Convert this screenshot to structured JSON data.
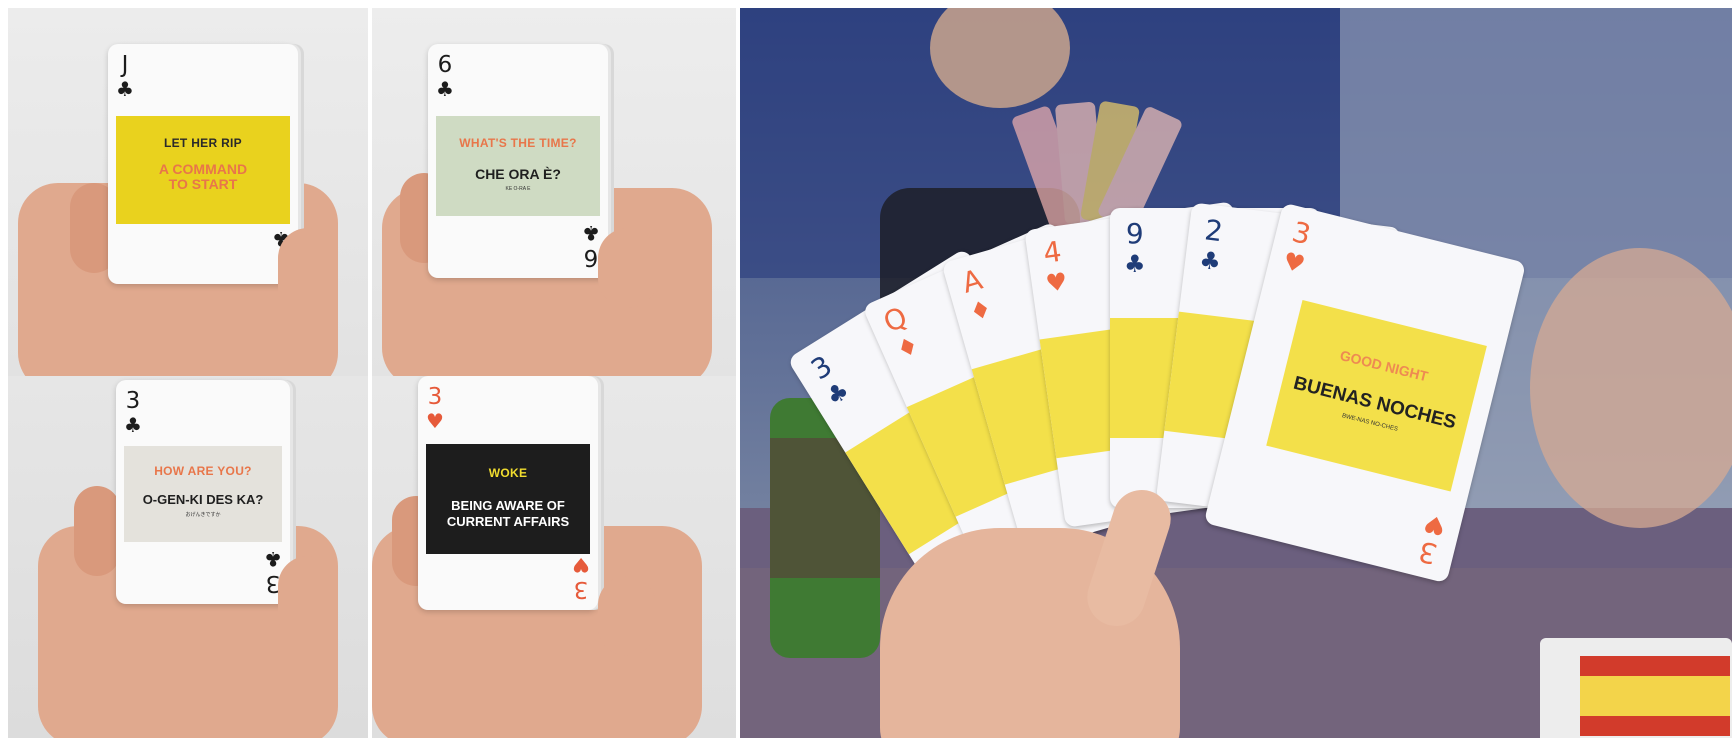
{
  "cards": {
    "jack_clubs": {
      "rank": "J",
      "suit": "♣",
      "phrase": "LET HER RIP",
      "translation": "A COMMAND\nTO START",
      "phonetic": "",
      "band_color": "#e9d21e",
      "phrase_color": "#2a2a2a",
      "translation_color": "#e8764a"
    },
    "six_clubs": {
      "rank": "6",
      "suit": "♣",
      "phrase": "WHAT'S THE TIME?",
      "translation": "CHE ORA È?",
      "phonetic": "KE O-RA E",
      "band_color": "#cfdbc3",
      "phrase_color": "#e8764a",
      "translation_color": "#1f1f1f"
    },
    "three_clubs": {
      "rank": "3",
      "suit": "♣",
      "phrase": "HOW ARE YOU?",
      "translation": "O-GEN-KI DES KA?",
      "phonetic": "おげんきですか",
      "band_color": "#e4e2dc",
      "phrase_color": "#e8764a",
      "translation_color": "#1f1f1f"
    },
    "three_hearts": {
      "rank": "3",
      "suit": "♥",
      "phrase": "WOKE",
      "translation": "BEING AWARE OF\nCURRENT AFFAIRS",
      "phonetic": "",
      "band_color": "#1d1d1d",
      "phrase_color": "#f1dd2f",
      "translation_color": "#ffffff"
    }
  },
  "fan": {
    "cards": [
      {
        "rank": "3",
        "suit": "♣",
        "color": "#1f3c78"
      },
      {
        "rank": "Q",
        "suit": "♦",
        "color": "#ee6a42"
      },
      {
        "rank": "A",
        "suit": "♦",
        "color": "#ee6a42"
      },
      {
        "rank": "4",
        "suit": "♥",
        "color": "#ee6a42"
      },
      {
        "rank": "9",
        "suit": "♣",
        "color": "#1f3c78"
      },
      {
        "rank": "2",
        "suit": "♣",
        "color": "#1f3c78"
      },
      {
        "rank": "3",
        "suit": "♥",
        "color": "#ee6a42"
      }
    ],
    "front_card": {
      "phrase": "GOOD NIGHT",
      "translation": "BUENAS NOCHES",
      "phonetic": "BWE-NAS NO-CHES",
      "corner_rank": "3",
      "corner_suit": "♥"
    }
  }
}
